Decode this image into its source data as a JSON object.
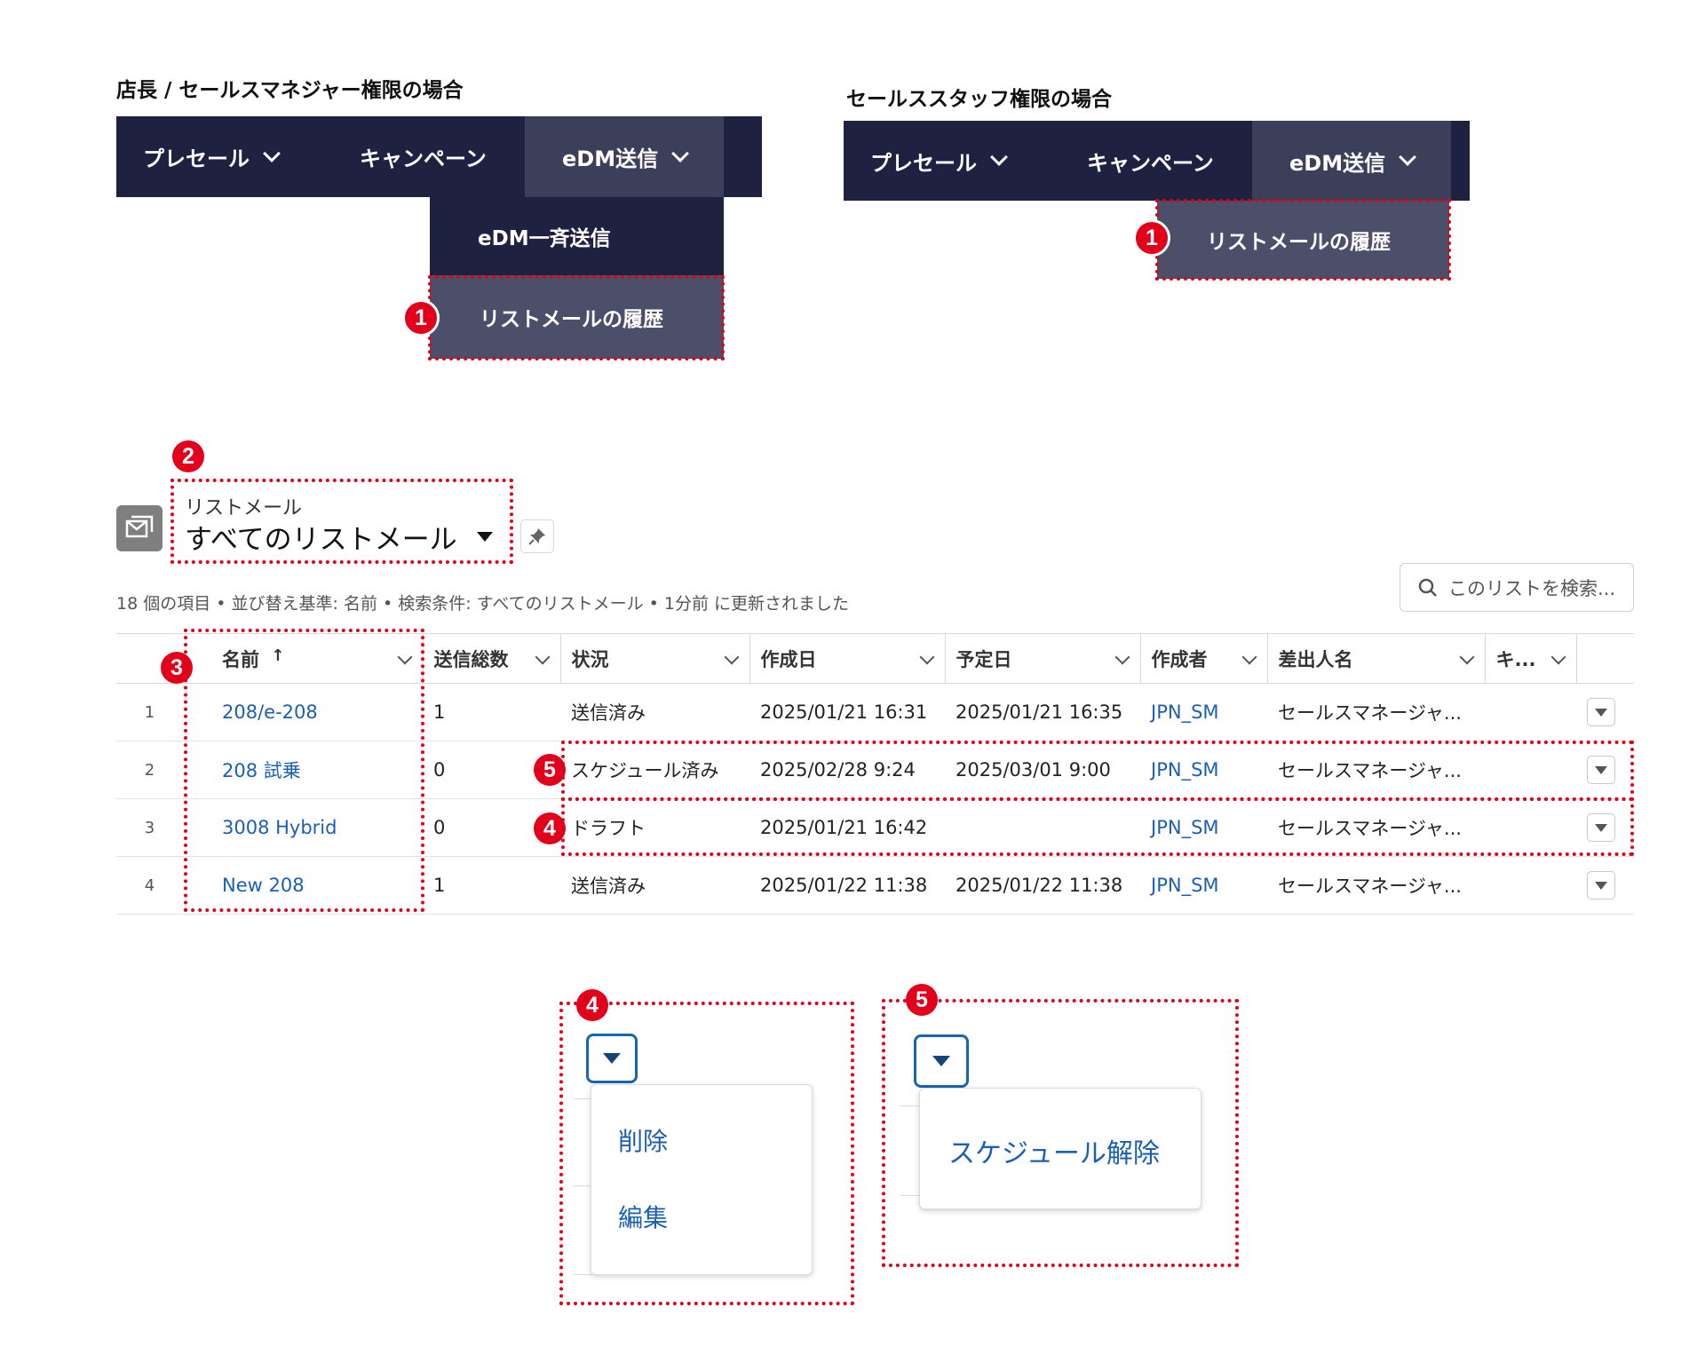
{
  "manager_section": {
    "heading": "店長 / セールスマネジャー権限の場合",
    "nav": {
      "presale": "プレセール",
      "campaign": "キャンペーン",
      "edm": "eDM送信"
    },
    "dropdown": {
      "bulk_send": "eDM一斉送信",
      "history": "リストメールの履歴"
    },
    "badge": "1"
  },
  "staff_section": {
    "heading": "セールススタッフ権限の場合",
    "nav": {
      "presale": "プレセール",
      "campaign": "キャンペーン",
      "edm": "eDM送信"
    },
    "dropdown": {
      "history": "リストメールの履歴"
    },
    "badge": "1"
  },
  "list_view": {
    "badge": "2",
    "object_label": "リストメール",
    "view_name": "すべてのリストメール",
    "meta": "18 個の項目 • 並び替え基準: 名前 • 検索条件: すべてのリストメール • 1分前 に更新されました",
    "search_placeholder": "このリストを検索..."
  },
  "table": {
    "badges": {
      "name_col": "3",
      "scheduled_row": "5",
      "draft_row": "4"
    },
    "sort_arrow": "↑",
    "columns": [
      "名前",
      "送信総数",
      "状況",
      "作成日",
      "予定日",
      "作成者",
      "差出人名",
      "キ..."
    ],
    "rows": [
      {
        "num": "1",
        "name": "208/e-208",
        "total": "1",
        "status": "送信済み",
        "created": "2025/01/21 16:31",
        "scheduled": "2025/01/21 16:35",
        "creator": "JPN_SM",
        "sender": "セールスマネージャ..."
      },
      {
        "num": "2",
        "name": "208 試乗",
        "total": "0",
        "status": "スケジュール済み",
        "created": "2025/02/28 9:24",
        "scheduled": "2025/03/01 9:00",
        "creator": "JPN_SM",
        "sender": "セールスマネージャ..."
      },
      {
        "num": "3",
        "name": "3008 Hybrid",
        "total": "0",
        "status": "ドラフト",
        "created": "2025/01/21 16:42",
        "scheduled": "",
        "creator": "JPN_SM",
        "sender": "セールスマネージャ..."
      },
      {
        "num": "4",
        "name": "New 208",
        "total": "1",
        "status": "送信済み",
        "created": "2025/01/22 11:38",
        "scheduled": "2025/01/22 11:38",
        "creator": "JPN_SM",
        "sender": "セールスマネージャ..."
      }
    ]
  },
  "draft_menu": {
    "badge": "4",
    "delete": "削除",
    "edit": "編集"
  },
  "scheduled_menu": {
    "badge": "5",
    "unschedule": "スケジュール解除"
  },
  "colors": {
    "nav_bg": "#1f2141",
    "nav_active": "#3c3f5a",
    "highlight_item": "#4c4f69",
    "annotation_red": "#e3001b",
    "link_blue": "#1b5fb5"
  }
}
